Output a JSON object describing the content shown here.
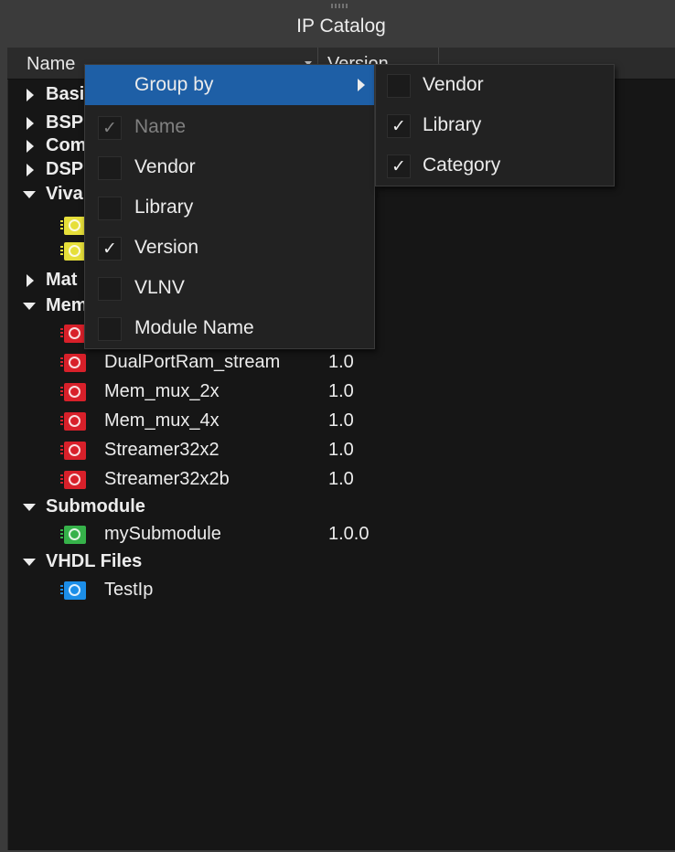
{
  "panel": {
    "title": "IP Catalog"
  },
  "columns": {
    "name": "Name",
    "version": "Version"
  },
  "tree": {
    "categories": [
      {
        "label": "Basic",
        "expanded": false
      },
      {
        "label": "BSP",
        "expanded": false
      },
      {
        "label": "Com",
        "expanded": false
      },
      {
        "label": "DSP",
        "expanded": false
      },
      {
        "label": "Viva",
        "expanded": true
      },
      {
        "label": "Mat",
        "expanded": false
      },
      {
        "label": "Mem",
        "expanded": true
      },
      {
        "label": "Submodule",
        "expanded": true
      },
      {
        "label": "VHDL Files",
        "expanded": true
      }
    ],
    "items": [
      {
        "name": "DualPortRam_stream",
        "version": "1.0",
        "icon_color": "#d8202a"
      },
      {
        "name": "Mem_mux_2x",
        "version": "1.0",
        "icon_color": "#d8202a"
      },
      {
        "name": "Mem_mux_4x",
        "version": "1.0",
        "icon_color": "#d8202a"
      },
      {
        "name": "Streamer32x2",
        "version": "1.0",
        "icon_color": "#d8202a"
      },
      {
        "name": "Streamer32x2b",
        "version": "1.0",
        "icon_color": "#d8202a"
      },
      {
        "name": "mySubmodule",
        "version": "1.0.0",
        "icon_color": "#36b24a"
      },
      {
        "name": "TestIp",
        "version": "",
        "icon_color": "#1c8ee8"
      }
    ]
  },
  "context_menu": {
    "group_by": "Group by",
    "items": [
      {
        "label": "Name",
        "checked": true,
        "enabled": false
      },
      {
        "label": "Vendor",
        "checked": false,
        "enabled": true
      },
      {
        "label": "Library",
        "checked": false,
        "enabled": true
      },
      {
        "label": "Version",
        "checked": true,
        "enabled": true
      },
      {
        "label": "VLNV",
        "checked": false,
        "enabled": true
      },
      {
        "label": "Module Name",
        "checked": false,
        "enabled": true
      }
    ]
  },
  "group_by_menu": {
    "items": [
      {
        "label": "Vendor",
        "checked": false
      },
      {
        "label": "Library",
        "checked": true
      },
      {
        "label": "Category",
        "checked": true
      }
    ]
  },
  "check_glyph": "✓",
  "colors": {
    "background": "#161616",
    "highlight": "#1e5fa6",
    "menu": "#222222"
  }
}
